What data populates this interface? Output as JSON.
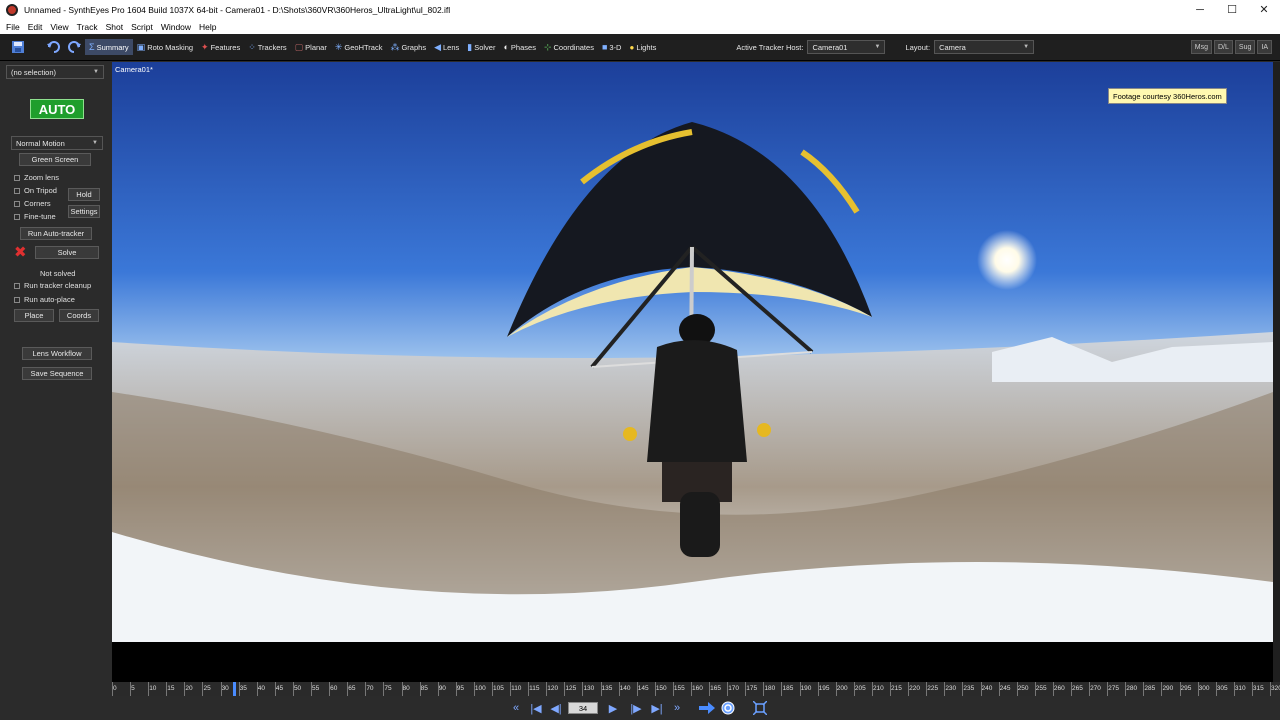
{
  "window": {
    "title": "Unnamed - SynthEyes Pro 1604 Build 1037X 64-bit - Camera01 - D:\\Shots\\360VR\\360Heros_UltraLight\\ul_802.ifl",
    "controls": [
      "─",
      "☐",
      "✕"
    ]
  },
  "menu": [
    "File",
    "Edit",
    "View",
    "Track",
    "Shot",
    "Script",
    "Window",
    "Help"
  ],
  "toolbar": {
    "rooms": [
      {
        "label": "Summary",
        "icon": "Σ",
        "active": true
      },
      {
        "label": "Roto Masking",
        "icon": "▣"
      },
      {
        "label": "Features",
        "icon": "✦"
      },
      {
        "label": "Trackers",
        "icon": "⁘"
      },
      {
        "label": "Planar",
        "icon": "▢"
      },
      {
        "label": "GeoHTrack",
        "icon": "✳"
      },
      {
        "label": "Graphs",
        "icon": "⁂"
      },
      {
        "label": "Lens",
        "icon": "◀"
      },
      {
        "label": "Solver",
        "icon": "▮"
      },
      {
        "label": "Phases",
        "icon": "◐"
      },
      {
        "label": "Coordinates",
        "icon": "⊹"
      },
      {
        "label": "3-D",
        "icon": "■"
      },
      {
        "label": "Lights",
        "icon": "💡"
      }
    ],
    "active_tracker_host_label": "Active Tracker Host:",
    "active_tracker_host_value": "Camera01",
    "layout_label": "Layout:",
    "layout_value": "Camera",
    "right_buttons": [
      "Msg",
      "D/L",
      "Sug",
      "IA"
    ]
  },
  "left_panel": {
    "selection": "(no selection)",
    "auto_label": "AUTO",
    "motion_mode": "Normal Motion",
    "green_screen": "Green Screen",
    "checks": {
      "zoom_lens": "Zoom lens",
      "on_tripod": "On Tripod",
      "corners": "Corners",
      "fine_tune": "Fine-tune"
    },
    "hold": "Hold",
    "settings": "Settings",
    "run_auto_tracker": "Run Auto-tracker",
    "solve": "Solve",
    "status": "Not solved",
    "run_tracker_cleanup": "Run tracker cleanup",
    "run_auto_place": "Run auto-place",
    "place": "Place",
    "coords": "Coords",
    "lens_workflow": "Lens Workflow",
    "save_sequence": "Save Sequence"
  },
  "viewport": {
    "camera_label": "Camera01*",
    "footage_credit": "Footage courtesy 360Heros.com"
  },
  "timeline": {
    "ticks": [
      "0",
      "5",
      "10",
      "15",
      "20",
      "25",
      "30",
      "35",
      "40",
      "45",
      "50",
      "55",
      "60",
      "65",
      "70",
      "75",
      "80",
      "85",
      "90",
      "95",
      "100",
      "105",
      "110",
      "115",
      "120",
      "125",
      "130",
      "135",
      "140",
      "145",
      "150",
      "155",
      "160",
      "165",
      "170",
      "175",
      "180",
      "185",
      "190",
      "195",
      "200",
      "205",
      "210",
      "215",
      "220",
      "225",
      "230",
      "235",
      "240",
      "245",
      "250",
      "255",
      "260",
      "265",
      "270",
      "275",
      "280",
      "285",
      "290",
      "295",
      "300",
      "305",
      "310",
      "315",
      "320"
    ],
    "current_frame": "34"
  },
  "playback": {
    "buttons": [
      "«",
      "|◀",
      "◀|",
      "▶",
      "|▶",
      "▶|",
      "»"
    ]
  }
}
